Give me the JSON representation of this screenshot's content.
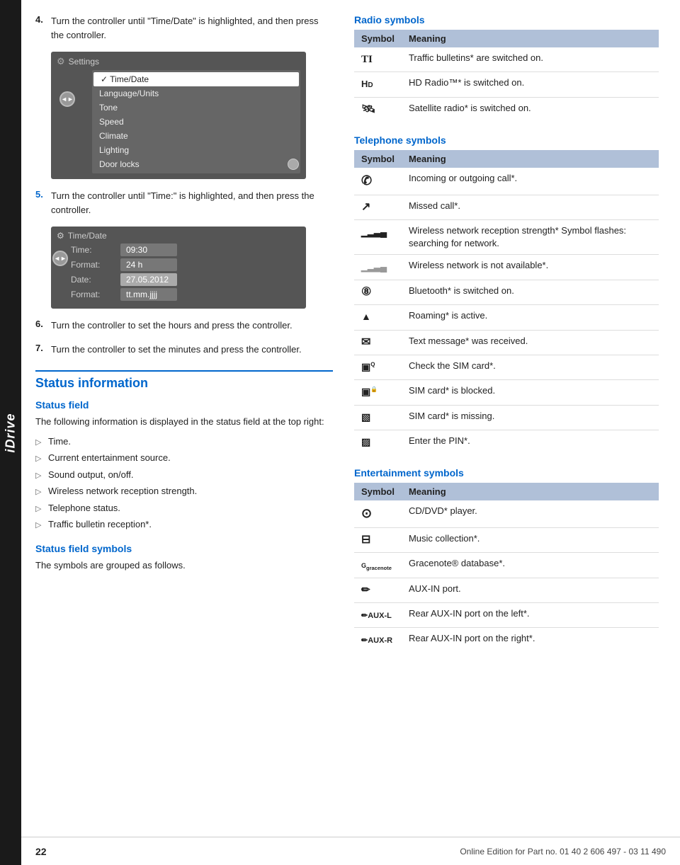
{
  "idrive_label": "iDrive",
  "left_col": {
    "step4_num": "4.",
    "step4_text": "Turn the controller until \"Time/Date\" is highlighted, and then press the controller.",
    "settings_title": "Settings",
    "menu_items": [
      {
        "label": "Time/Date",
        "selected": true
      },
      {
        "label": "Language/Units"
      },
      {
        "label": "Tone"
      },
      {
        "label": "Speed"
      },
      {
        "label": "Climate"
      },
      {
        "label": "Lighting"
      },
      {
        "label": "Door locks"
      }
    ],
    "step5_num": "5.",
    "step5_text": "Turn the controller until \"Time:\" is highlighted, and then press the controller.",
    "timedate_title": "Time/Date",
    "fields": [
      {
        "label": "Time:",
        "value": "09:30",
        "highlighted": false
      },
      {
        "label": "Format:",
        "value": "24 h",
        "highlighted": false
      },
      {
        "label": "Date:",
        "value": "27.05.2012",
        "highlighted": true
      },
      {
        "label": "Format:",
        "value": "tt.mm.jjjj",
        "highlighted": false
      }
    ],
    "step6_num": "6.",
    "step6_text": "Turn the controller to set the hours and press the controller.",
    "step7_num": "7.",
    "step7_text": "Turn the controller to set the minutes and press the controller.",
    "status_section_title": "Status information",
    "status_field_title": "Status field",
    "status_field_desc": "The following information is displayed in the status field at the top right:",
    "bullets": [
      "Time.",
      "Current entertainment source.",
      "Sound output, on/off.",
      "Wireless network reception strength.",
      "Telephone status.",
      "Traffic bulletin reception*."
    ],
    "status_symbols_title": "Status field symbols",
    "status_symbols_desc": "The symbols are grouped as follows."
  },
  "right_col": {
    "radio_section_title": "Radio symbols",
    "radio_table": {
      "col1": "Symbol",
      "col2": "Meaning",
      "rows": [
        {
          "symbol": "TI",
          "meaning": "Traffic bulletins* are switched on.",
          "symbol_type": "ti"
        },
        {
          "symbol": "HD",
          "meaning": "HD Radio™* is switched on.",
          "symbol_type": "hd"
        },
        {
          "symbol": "🛰",
          "meaning": "Satellite radio* is switched on.",
          "symbol_type": "sat"
        }
      ]
    },
    "telephone_section_title": "Telephone symbols",
    "telephone_table": {
      "col1": "Symbol",
      "col2": "Meaning",
      "rows": [
        {
          "symbol": "✆",
          "meaning": "Incoming or outgoing call*.",
          "symbol_type": "phone"
        },
        {
          "symbol": "↗",
          "meaning": "Missed call*.",
          "symbol_type": "missed"
        },
        {
          "symbol": "▁▂▃▄",
          "meaning": "Wireless network reception strength* Symbol flashes: searching for network.",
          "symbol_type": "signal"
        },
        {
          "symbol": "▁▂▃",
          "meaning": "Wireless network is not available*.",
          "symbol_type": "signal-x"
        },
        {
          "symbol": "⑧",
          "meaning": "Bluetooth* is switched on.",
          "symbol_type": "bt"
        },
        {
          "symbol": "▲",
          "meaning": "Roaming* is active.",
          "symbol_type": "roam"
        },
        {
          "symbol": "✉",
          "meaning": "Text message* was received.",
          "symbol_type": "msg"
        },
        {
          "symbol": "▣",
          "meaning": "Check the SIM card*.",
          "symbol_type": "simcheck"
        },
        {
          "symbol": "▣",
          "meaning": "SIM card* is blocked.",
          "symbol_type": "simblock"
        },
        {
          "symbol": "▧",
          "meaning": "SIM card* is missing.",
          "symbol_type": "simmiss"
        },
        {
          "symbol": "▨",
          "meaning": "Enter the PIN*.",
          "symbol_type": "pin"
        }
      ]
    },
    "entertainment_section_title": "Entertainment symbols",
    "entertainment_table": {
      "col1": "Symbol",
      "col2": "Meaning",
      "rows": [
        {
          "symbol": "⊙",
          "meaning": "CD/DVD* player.",
          "symbol_type": "cd"
        },
        {
          "symbol": "⊟",
          "meaning": "Music collection*.",
          "symbol_type": "music"
        },
        {
          "symbol": "G gracenote",
          "meaning": "Gracenote® database*.",
          "symbol_type": "gracenote"
        },
        {
          "symbol": "✏",
          "meaning": "AUX-IN port.",
          "symbol_type": "aux"
        },
        {
          "symbol": "✏AUX-L",
          "meaning": "Rear AUX-IN port on the left*.",
          "symbol_type": "auxl"
        },
        {
          "symbol": "✏AUX-R",
          "meaning": "Rear AUX-IN port on the right*.",
          "symbol_type": "auxr"
        }
      ]
    }
  },
  "footer": {
    "page_number": "22",
    "footer_text": "Online Edition for Part no. 01 40 2 606 497 - 03 11 490"
  }
}
